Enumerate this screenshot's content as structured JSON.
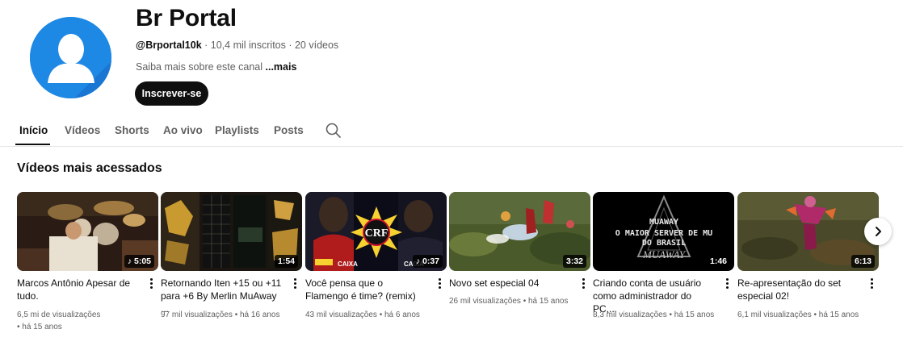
{
  "channel": {
    "name": "Br Portal",
    "handle": "@Brportal10k",
    "meta_rest": " · 10,4 mil inscritos · 20 vídeos",
    "about": "Saiba mais sobre este canal ",
    "about_more": "...mais",
    "subscribe_label": "Inscrever-se"
  },
  "tabs": [
    {
      "label": "Início",
      "active": true
    },
    {
      "label": "Vídeos"
    },
    {
      "label": "Shorts"
    },
    {
      "label": "Ao vivo"
    },
    {
      "label": "Playlists"
    },
    {
      "label": "Posts"
    }
  ],
  "section": {
    "title": "Vídeos mais acessados"
  },
  "videos": [
    {
      "title": "Marcos Antônio Apesar de tudo.",
      "views": "6,5 mi de visualizações",
      "age": "• há 15 anos",
      "duration": "5:05",
      "music_icon": true
    },
    {
      "title": "Retornando Iten +15 ou +11 para +6 By Merlin MuAway ...",
      "views": "97 mil visualizações",
      "age": "• há 16 anos",
      "duration": "1:54"
    },
    {
      "title": "Você pensa que o Flamengo é time? (remix)",
      "views": "43 mil visualizações",
      "age": "• há 6 anos",
      "duration": "0:37",
      "music_icon": true
    },
    {
      "title": "Novo set especial 04",
      "views": "26 mil visualizações",
      "age": "• há 15 anos",
      "duration": "3:32"
    },
    {
      "title": "Criando conta de usuário como administrador do PC,...",
      "views": "8,3 mil visualizações",
      "age": "• há 15 anos",
      "duration": "1:46"
    },
    {
      "title": "Re-apresentação do set especial 02!",
      "views": "6,1 mil visualizações",
      "age": "• há 15 anos",
      "duration": "6:13"
    }
  ],
  "thumb_text": {
    "muaway_line1": "MUAWAY",
    "muaway_line2": "O MAIOR SERVER DE MU",
    "muaway_line3": "DO BRASIL",
    "muaway_logo": "MUAWAY",
    "flamengo_caixa": "CAIXA",
    "flamengo_crest": "CRF"
  },
  "icons": {
    "avatar": "default-avatar-icon",
    "search": "search-icon",
    "next": "chevron-right-icon",
    "more": "more-vert-icon",
    "music": "music-note-icon"
  },
  "colors": {
    "avatar_bg": "#1e88e5",
    "subscribe_bg": "#0f0f0f"
  }
}
